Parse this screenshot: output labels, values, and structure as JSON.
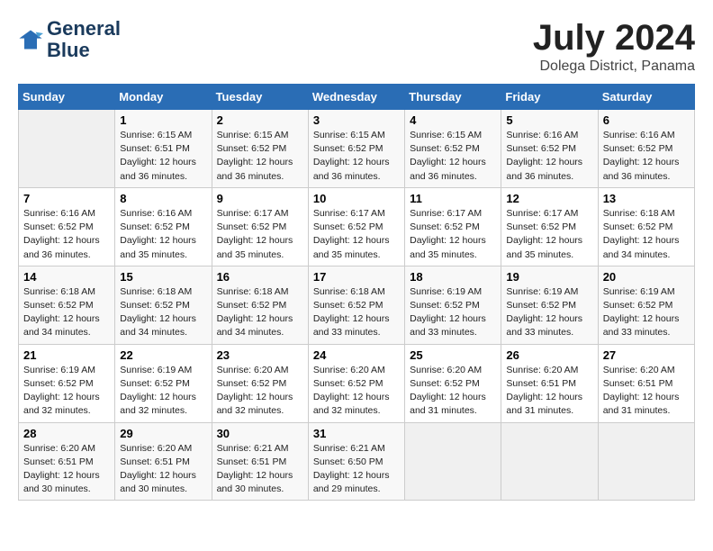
{
  "header": {
    "logo_line1": "General",
    "logo_line2": "Blue",
    "title": "July 2024",
    "subtitle": "Dolega District, Panama"
  },
  "calendar": {
    "days_of_week": [
      "Sunday",
      "Monday",
      "Tuesday",
      "Wednesday",
      "Thursday",
      "Friday",
      "Saturday"
    ],
    "weeks": [
      [
        {
          "day": "",
          "sunrise": "",
          "sunset": "",
          "daylight": ""
        },
        {
          "day": "1",
          "sunrise": "Sunrise: 6:15 AM",
          "sunset": "Sunset: 6:51 PM",
          "daylight": "Daylight: 12 hours and 36 minutes."
        },
        {
          "day": "2",
          "sunrise": "Sunrise: 6:15 AM",
          "sunset": "Sunset: 6:52 PM",
          "daylight": "Daylight: 12 hours and 36 minutes."
        },
        {
          "day": "3",
          "sunrise": "Sunrise: 6:15 AM",
          "sunset": "Sunset: 6:52 PM",
          "daylight": "Daylight: 12 hours and 36 minutes."
        },
        {
          "day": "4",
          "sunrise": "Sunrise: 6:15 AM",
          "sunset": "Sunset: 6:52 PM",
          "daylight": "Daylight: 12 hours and 36 minutes."
        },
        {
          "day": "5",
          "sunrise": "Sunrise: 6:16 AM",
          "sunset": "Sunset: 6:52 PM",
          "daylight": "Daylight: 12 hours and 36 minutes."
        },
        {
          "day": "6",
          "sunrise": "Sunrise: 6:16 AM",
          "sunset": "Sunset: 6:52 PM",
          "daylight": "Daylight: 12 hours and 36 minutes."
        }
      ],
      [
        {
          "day": "7",
          "sunrise": "Sunrise: 6:16 AM",
          "sunset": "Sunset: 6:52 PM",
          "daylight": "Daylight: 12 hours and 36 minutes."
        },
        {
          "day": "8",
          "sunrise": "Sunrise: 6:16 AM",
          "sunset": "Sunset: 6:52 PM",
          "daylight": "Daylight: 12 hours and 35 minutes."
        },
        {
          "day": "9",
          "sunrise": "Sunrise: 6:17 AM",
          "sunset": "Sunset: 6:52 PM",
          "daylight": "Daylight: 12 hours and 35 minutes."
        },
        {
          "day": "10",
          "sunrise": "Sunrise: 6:17 AM",
          "sunset": "Sunset: 6:52 PM",
          "daylight": "Daylight: 12 hours and 35 minutes."
        },
        {
          "day": "11",
          "sunrise": "Sunrise: 6:17 AM",
          "sunset": "Sunset: 6:52 PM",
          "daylight": "Daylight: 12 hours and 35 minutes."
        },
        {
          "day": "12",
          "sunrise": "Sunrise: 6:17 AM",
          "sunset": "Sunset: 6:52 PM",
          "daylight": "Daylight: 12 hours and 35 minutes."
        },
        {
          "day": "13",
          "sunrise": "Sunrise: 6:18 AM",
          "sunset": "Sunset: 6:52 PM",
          "daylight": "Daylight: 12 hours and 34 minutes."
        }
      ],
      [
        {
          "day": "14",
          "sunrise": "Sunrise: 6:18 AM",
          "sunset": "Sunset: 6:52 PM",
          "daylight": "Daylight: 12 hours and 34 minutes."
        },
        {
          "day": "15",
          "sunrise": "Sunrise: 6:18 AM",
          "sunset": "Sunset: 6:52 PM",
          "daylight": "Daylight: 12 hours and 34 minutes."
        },
        {
          "day": "16",
          "sunrise": "Sunrise: 6:18 AM",
          "sunset": "Sunset: 6:52 PM",
          "daylight": "Daylight: 12 hours and 34 minutes."
        },
        {
          "day": "17",
          "sunrise": "Sunrise: 6:18 AM",
          "sunset": "Sunset: 6:52 PM",
          "daylight": "Daylight: 12 hours and 33 minutes."
        },
        {
          "day": "18",
          "sunrise": "Sunrise: 6:19 AM",
          "sunset": "Sunset: 6:52 PM",
          "daylight": "Daylight: 12 hours and 33 minutes."
        },
        {
          "day": "19",
          "sunrise": "Sunrise: 6:19 AM",
          "sunset": "Sunset: 6:52 PM",
          "daylight": "Daylight: 12 hours and 33 minutes."
        },
        {
          "day": "20",
          "sunrise": "Sunrise: 6:19 AM",
          "sunset": "Sunset: 6:52 PM",
          "daylight": "Daylight: 12 hours and 33 minutes."
        }
      ],
      [
        {
          "day": "21",
          "sunrise": "Sunrise: 6:19 AM",
          "sunset": "Sunset: 6:52 PM",
          "daylight": "Daylight: 12 hours and 32 minutes."
        },
        {
          "day": "22",
          "sunrise": "Sunrise: 6:19 AM",
          "sunset": "Sunset: 6:52 PM",
          "daylight": "Daylight: 12 hours and 32 minutes."
        },
        {
          "day": "23",
          "sunrise": "Sunrise: 6:20 AM",
          "sunset": "Sunset: 6:52 PM",
          "daylight": "Daylight: 12 hours and 32 minutes."
        },
        {
          "day": "24",
          "sunrise": "Sunrise: 6:20 AM",
          "sunset": "Sunset: 6:52 PM",
          "daylight": "Daylight: 12 hours and 32 minutes."
        },
        {
          "day": "25",
          "sunrise": "Sunrise: 6:20 AM",
          "sunset": "Sunset: 6:52 PM",
          "daylight": "Daylight: 12 hours and 31 minutes."
        },
        {
          "day": "26",
          "sunrise": "Sunrise: 6:20 AM",
          "sunset": "Sunset: 6:51 PM",
          "daylight": "Daylight: 12 hours and 31 minutes."
        },
        {
          "day": "27",
          "sunrise": "Sunrise: 6:20 AM",
          "sunset": "Sunset: 6:51 PM",
          "daylight": "Daylight: 12 hours and 31 minutes."
        }
      ],
      [
        {
          "day": "28",
          "sunrise": "Sunrise: 6:20 AM",
          "sunset": "Sunset: 6:51 PM",
          "daylight": "Daylight: 12 hours and 30 minutes."
        },
        {
          "day": "29",
          "sunrise": "Sunrise: 6:20 AM",
          "sunset": "Sunset: 6:51 PM",
          "daylight": "Daylight: 12 hours and 30 minutes."
        },
        {
          "day": "30",
          "sunrise": "Sunrise: 6:21 AM",
          "sunset": "Sunset: 6:51 PM",
          "daylight": "Daylight: 12 hours and 30 minutes."
        },
        {
          "day": "31",
          "sunrise": "Sunrise: 6:21 AM",
          "sunset": "Sunset: 6:50 PM",
          "daylight": "Daylight: 12 hours and 29 minutes."
        },
        {
          "day": "",
          "sunrise": "",
          "sunset": "",
          "daylight": ""
        },
        {
          "day": "",
          "sunrise": "",
          "sunset": "",
          "daylight": ""
        },
        {
          "day": "",
          "sunrise": "",
          "sunset": "",
          "daylight": ""
        }
      ]
    ]
  }
}
